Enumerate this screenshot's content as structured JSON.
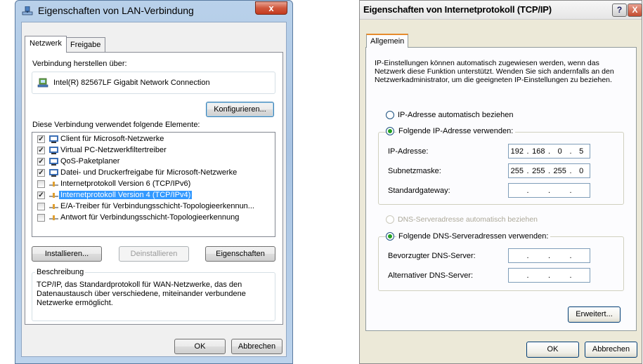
{
  "left_dialog": {
    "title": "Eigenschaften von LAN-Verbindung",
    "close": "x",
    "tabs": [
      "Netzwerk",
      "Freigabe"
    ],
    "connect_using_label": "Verbindung herstellen über:",
    "adapter_name": "Intel(R) 82567LF Gigabit Network Connection",
    "configure_button": "Konfigurieren...",
    "items_label": "Diese Verbindung verwendet folgende Elemente:",
    "items": [
      {
        "label": "Client für Microsoft-Netzwerke",
        "checked": true,
        "icon": "network-client-icon"
      },
      {
        "label": "Virtual PC-Netzwerkfiltertreiber",
        "checked": true,
        "icon": "network-service-icon"
      },
      {
        "label": "QoS-Paketplaner",
        "checked": true,
        "icon": "network-service-icon"
      },
      {
        "label": "Datei- und Druckerfreigabe für Microsoft-Netzwerke",
        "checked": true,
        "icon": "network-service-icon"
      },
      {
        "label": "Internetprotokoll Version 6 (TCP/IPv6)",
        "checked": false,
        "icon": "protocol-icon"
      },
      {
        "label": "Internetprotokoll Version 4 (TCP/IPv4)",
        "checked": true,
        "icon": "protocol-icon",
        "selected": true
      },
      {
        "label": "E/A-Treiber für Verbindungsschicht-Topologieerkennun...",
        "checked": false,
        "icon": "protocol-icon"
      },
      {
        "label": "Antwort für Verbindungsschicht-Topologieerkennung",
        "checked": false,
        "icon": "protocol-icon"
      }
    ],
    "install_button": "Installieren...",
    "uninstall_button": "Deinstallieren",
    "properties_button": "Eigenschaften",
    "description_title": "Beschreibung",
    "description_text": "TCP/IP, das Standardprotokoll für WAN-Netzwerke, das den Datenaustausch über verschiedene, miteinander verbundene Netzwerke ermöglicht.",
    "ok_button": "OK",
    "cancel_button": "Abbrechen"
  },
  "right_dialog": {
    "title": "Eigenschaften von Internetprotokoll (TCP/IP)",
    "help": "?",
    "close": "X",
    "tab": "Allgemein",
    "intro": "IP-Einstellungen können automatisch zugewiesen werden, wenn das Netzwerk diese Funktion unterstützt. Wenden Sie sich andernfalls an den Netzwerkadministrator, um die geeigneten IP-Einstellungen zu beziehen.",
    "radio_auto_ip": "IP-Adresse automatisch beziehen",
    "radio_manual_ip": "Folgende IP-Adresse verwenden:",
    "ip_label": "IP-Adresse:",
    "ip_value": [
      "192",
      "168",
      "0",
      "5"
    ],
    "mask_label": "Subnetzmaske:",
    "mask_value": [
      "255",
      "255",
      "255",
      "0"
    ],
    "gateway_label": "Standardgateway:",
    "gateway_value": [
      "",
      "",
      "",
      ""
    ],
    "radio_auto_dns": "DNS-Serveradresse automatisch beziehen",
    "radio_manual_dns": "Folgende DNS-Serveradressen verwenden:",
    "dns1_label": "Bevorzugter DNS-Server:",
    "dns1_value": [
      "",
      "",
      "",
      ""
    ],
    "dns2_label": "Alternativer DNS-Server:",
    "dns2_value": [
      "",
      "",
      "",
      ""
    ],
    "advanced_button": "Erweitert...",
    "ok_button": "OK",
    "cancel_button": "Abbrechen"
  }
}
